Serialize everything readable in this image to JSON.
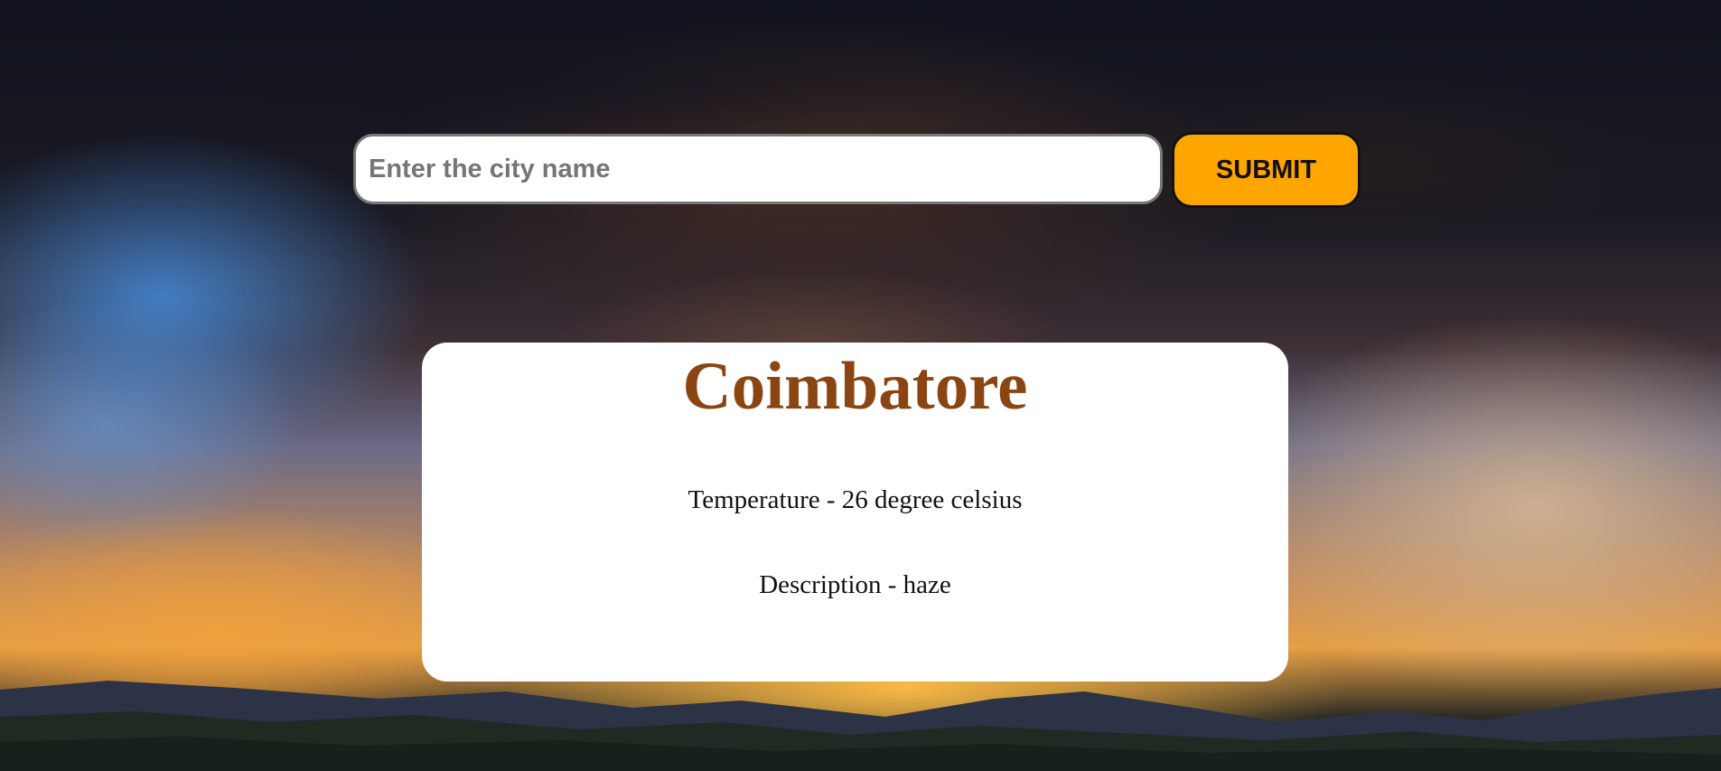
{
  "search": {
    "placeholder": "Enter the city name",
    "value": "",
    "submit_label": "SUBMIT"
  },
  "weather": {
    "city": "Coimbatore",
    "temperature_text": "Temperature - 26 degree celsius",
    "description_text": "Description - haze"
  },
  "colors": {
    "accent": "#ffa500",
    "city_name": "#8b4513",
    "card_background": "#ffffff"
  }
}
